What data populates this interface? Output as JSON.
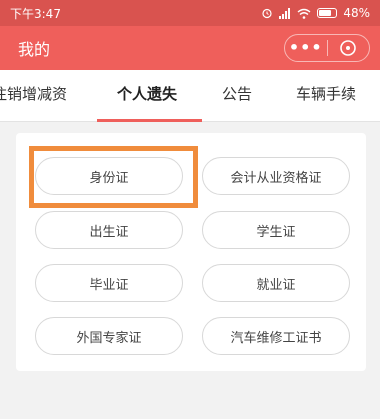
{
  "status_bar": {
    "time": "下午3:47",
    "battery": "48%",
    "icons": [
      "alarm-icon",
      "signal-icon",
      "wifi-icon",
      "battery-icon"
    ]
  },
  "header": {
    "title": "我的",
    "more_icon": "more-dots-icon",
    "close_icon": "close-circle-icon"
  },
  "tabs": [
    {
      "label": "注销增减资",
      "active": false
    },
    {
      "label": "个人遗失",
      "active": true
    },
    {
      "label": "公告",
      "active": false
    },
    {
      "label": "车辆手续",
      "active": false
    }
  ],
  "documents": [
    "身份证",
    "会计从业资格证",
    "出生证",
    "学生证",
    "毕业证",
    "就业证",
    "外国专家证",
    "汽车维修工证书"
  ],
  "colors": {
    "status_bar": "#d9534f",
    "title_bar": "#ef5f5b",
    "accent": "#ef5f5b",
    "highlight": "#f08c3c"
  }
}
